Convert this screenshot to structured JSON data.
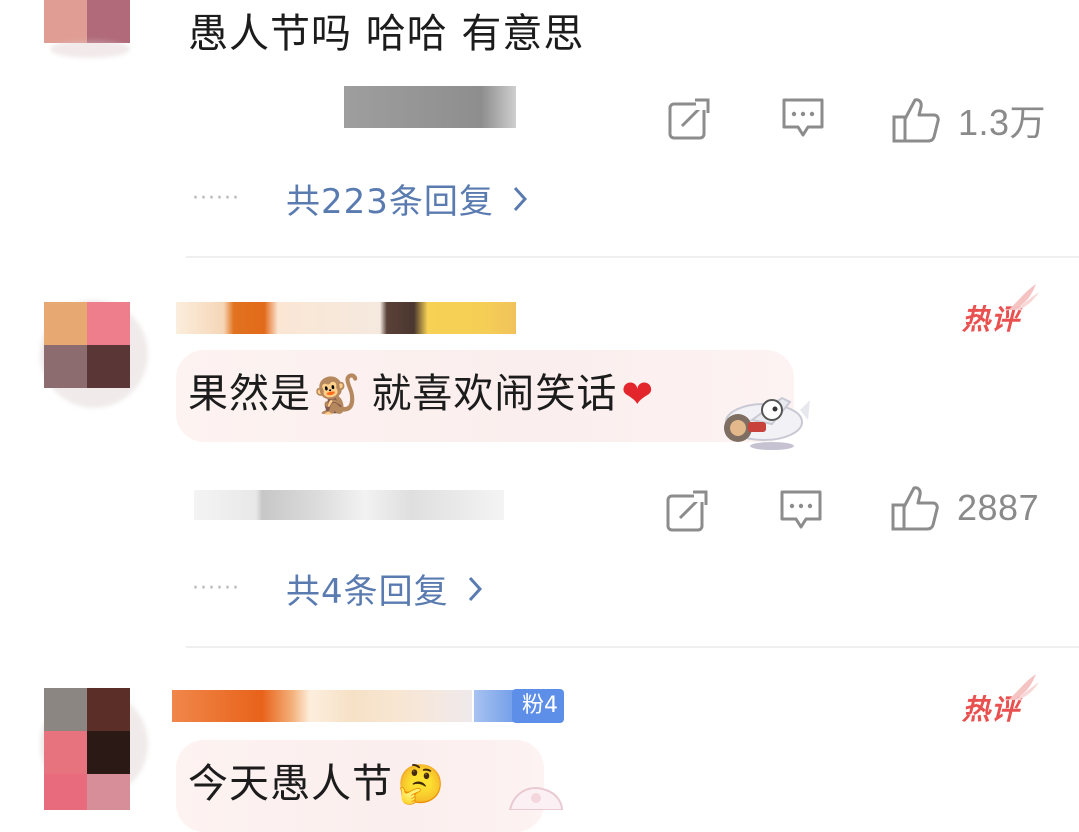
{
  "comments": [
    {
      "text": "愚人节吗 哈哈 有意思",
      "actions": {
        "repost_icon": "repost-icon",
        "comment_icon": "comment-icon",
        "like_icon": "thumbs-up-icon",
        "likes": "1.3万"
      },
      "replies": {
        "dots": "······",
        "label": "共223条回复"
      }
    },
    {
      "badge": "热评",
      "text_before": "果然是",
      "emoji_monkey": "🐒",
      "text_after": "就喜欢闹笑话",
      "emoji_heart": "❤",
      "actions": {
        "repost_icon": "repost-icon",
        "comment_icon": "comment-icon",
        "like_icon": "thumbs-up-icon",
        "likes": "2887"
      },
      "replies": {
        "dots": "······",
        "label": "共4条回复"
      }
    },
    {
      "badge": "热评",
      "fan_badge": "粉4",
      "text": "今天愚人节",
      "emoji_thinking": "🤔"
    }
  ],
  "colors": {
    "link": "#5a7bb0",
    "hot": "#e8514f",
    "icon": "#8c8c8c",
    "bubble": "#fbeeee"
  }
}
